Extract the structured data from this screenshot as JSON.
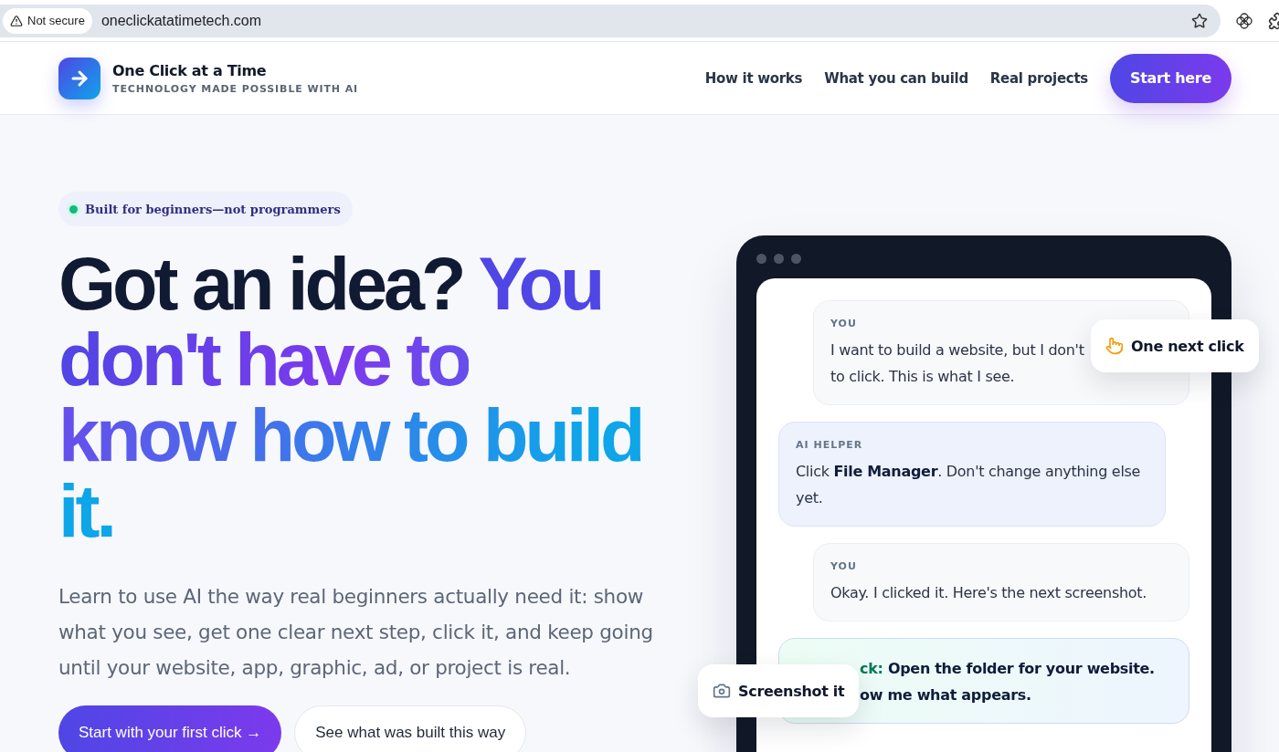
{
  "browser": {
    "security": "Not secure",
    "url": "oneclickatatimetech.com"
  },
  "header": {
    "brand": "One Click at a Time",
    "tagline": "TECHNOLOGY MADE POSSIBLE WITH AI",
    "nav": [
      {
        "label": "How it works"
      },
      {
        "label": "What you can build"
      },
      {
        "label": "Real projects"
      }
    ],
    "cta": "Start here"
  },
  "hero": {
    "badge": "Built for beginners—not programmers",
    "headline_lead": "Got an idea?",
    "headline_highlight": "You don't have to know how to build it.",
    "intro": "Learn to use AI the way real beginners actually need it: show what you see, get one clear next step, click it, and keep going until your website, app, graphic, ad, or project is real.",
    "buttons": [
      {
        "label": "Start with your first click →",
        "kind": "primary"
      },
      {
        "label": "See what was built this way",
        "kind": "secondary"
      }
    ]
  },
  "chat": {
    "messages": [
      {
        "kind": "user",
        "label": "YOU",
        "lines": [
          "I want to build a website, but I don't",
          "to click. This is what I see."
        ]
      },
      {
        "kind": "helper",
        "label": "AI HELPER",
        "lines": [
          "Click **File Manager**. Don't change anything else",
          "yet."
        ]
      },
      {
        "kind": "user",
        "label": "YOU",
        "lines": [
          "Okay. I clicked it. Here's the next screenshot."
        ]
      },
      {
        "kind": "next",
        "label": "ck:",
        "lines": [
          "Open the folder for your website.",
          "ow me what appears."
        ]
      }
    ],
    "floating": [
      {
        "kind": "hand",
        "label": "One next click"
      },
      {
        "kind": "camera",
        "label": "Screenshot it"
      }
    ]
  }
}
